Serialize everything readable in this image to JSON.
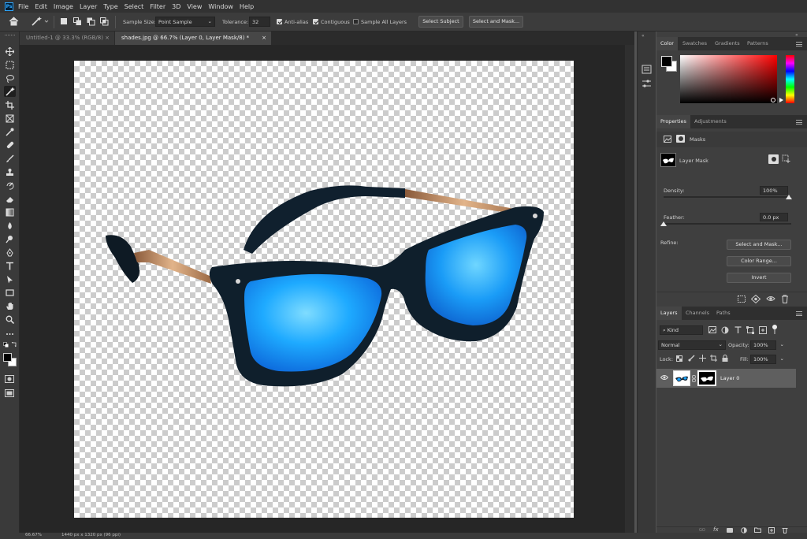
{
  "menubar": {
    "logo": "Ps",
    "items": [
      "File",
      "Edit",
      "Image",
      "Layer",
      "Type",
      "Select",
      "Filter",
      "3D",
      "View",
      "Window",
      "Help"
    ]
  },
  "options": {
    "sample_size_label": "Sample Size:",
    "sample_size_value": "Point Sample",
    "tolerance_label": "Tolerance:",
    "tolerance_value": "32",
    "anti_alias": "Anti-alias",
    "contiguous": "Contiguous",
    "sample_all_layers": "Sample All Layers",
    "select_subject": "Select Subject",
    "select_and_mask": "Select and Mask..."
  },
  "tabs": [
    {
      "label": "Untitled-1 @ 33.3% (RGB/8)",
      "close": "×"
    },
    {
      "label": "shades.jpg @ 66.7% (Layer 0, Layer Mask/8) *",
      "close": "×"
    }
  ],
  "status": {
    "zoom": "66.67%",
    "doc_info": "1440 px x 1320 px (96 ppi)"
  },
  "color_panel": {
    "tabs": [
      "Color",
      "Swatches",
      "Gradients",
      "Patterns"
    ]
  },
  "properties_panel": {
    "tabs": [
      "Properties",
      "Adjustments"
    ],
    "section": "Masks",
    "mask_name": "Layer Mask",
    "density_label": "Density:",
    "density_value": "100%",
    "feather_label": "Feather:",
    "feather_value": "0.0 px",
    "refine_label": "Refine:",
    "select_and_mask": "Select and Mask...",
    "color_range": "Color Range...",
    "invert": "Invert"
  },
  "layers_panel": {
    "tabs": [
      "Layers",
      "Channels",
      "Paths"
    ],
    "filter_kind": "Kind",
    "blend_mode": "Normal",
    "opacity_label": "Opacity:",
    "opacity_value": "100%",
    "lock_label": "Lock:",
    "fill_label": "Fill:",
    "fill_value": "100%",
    "layers": [
      {
        "name": "Layer 0",
        "visible": true
      }
    ]
  },
  "colors": {
    "accent": "#31a8ff",
    "lens": "#1aa3ff"
  }
}
